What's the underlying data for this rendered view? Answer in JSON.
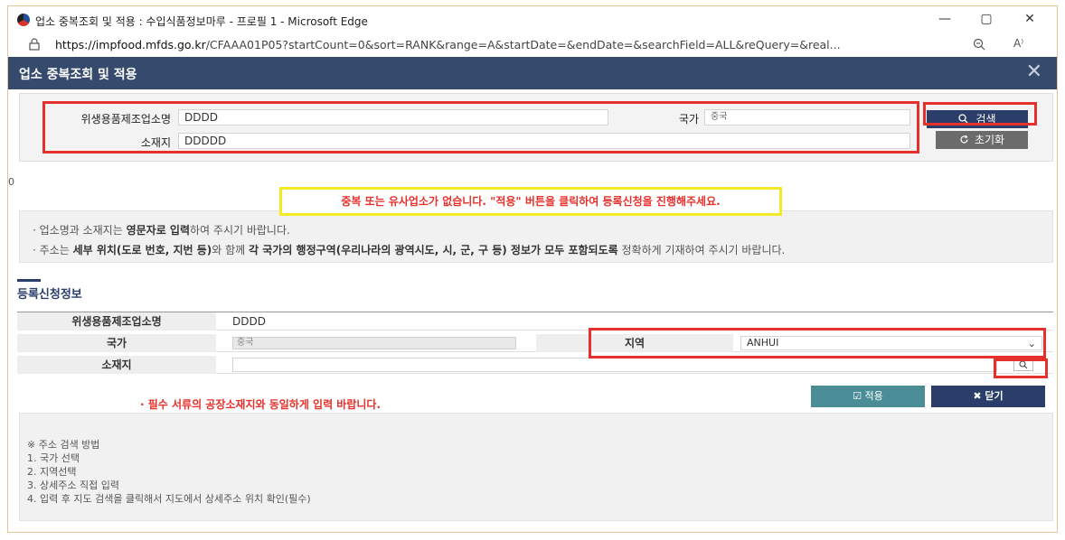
{
  "window": {
    "title": "업소 중복조회 및 적용 : 수입식품정보마루 - 프로필 1 - Microsoft Edge",
    "minimize": "—",
    "maximize": "▢",
    "close": "✕",
    "url_host": "https://impfood.mfds.go.kr",
    "url_rest": "/CFAAA01P05?startCount=0&sort=RANK&range=A&startDate=&endDate=&searchField=ALL&reQuery=&real...",
    "read_aloud": "A⁾"
  },
  "dialog": {
    "title": "업소 중복조회 및 적용",
    "close": "✕"
  },
  "search": {
    "manufacturer_label": "위생용품제조업소명",
    "manufacturer_value": "DDDD",
    "country_label": "국가",
    "country_value": "중국",
    "address_label": "소재지",
    "address_value": "DDDDD",
    "search_button": "검색",
    "reset_button": "초기화"
  },
  "result_count": "0",
  "message": "중복 또는 유사업소가 없습니다. \"적용\" 버튼을 클릭하여 등록신청을 진행해주세요.",
  "notes": {
    "line1_a": "· 업소명과 소재지는 ",
    "line1_b": "영문자로 입력",
    "line1_c": "하여 주시기 바랍니다.",
    "line2_a": "· 주소는 ",
    "line2_b": "세부 위치(도로 번호, 지번 등)",
    "line2_c": "와 함께 ",
    "line2_d": "각 국가의 행정구역(우리나라의 광역시도, 시, 군, 구 등) 정보가 모두 포함되도록",
    "line2_e": " 정확하게 기재하여 주시기 바랍니다."
  },
  "registration": {
    "section_title": "등록신청정보",
    "manufacturer_label": "위생용품제조업소명",
    "manufacturer_value": "DDDD",
    "country_label": "국가",
    "country_value": "중국",
    "region_label": "지역",
    "region_value": "ANHUI",
    "address_label": "소재지",
    "warning": "· 필수 서류의 공장소재지와 동일하게 입력 바랍니다.",
    "apply_button": "☑ 적용",
    "close_button": "✖ 닫기"
  },
  "guide": {
    "heading": "※ 주소 검색 방법",
    "step1": "1. 국가 선택",
    "step2": "2. 지역선택",
    "step3": "3. 상세주소 직접 입력",
    "step4": "4. 입력 후 지도 검색을 클릭해서 지도에서 상세주소 위치 확인(필수)"
  },
  "colors": {
    "header_bg": "#354a6c",
    "highlight_red": "#e5302b",
    "highlight_yellow": "#f2ea25",
    "apply_bg": "#4b8d97",
    "close_bg": "#2a3e69"
  }
}
